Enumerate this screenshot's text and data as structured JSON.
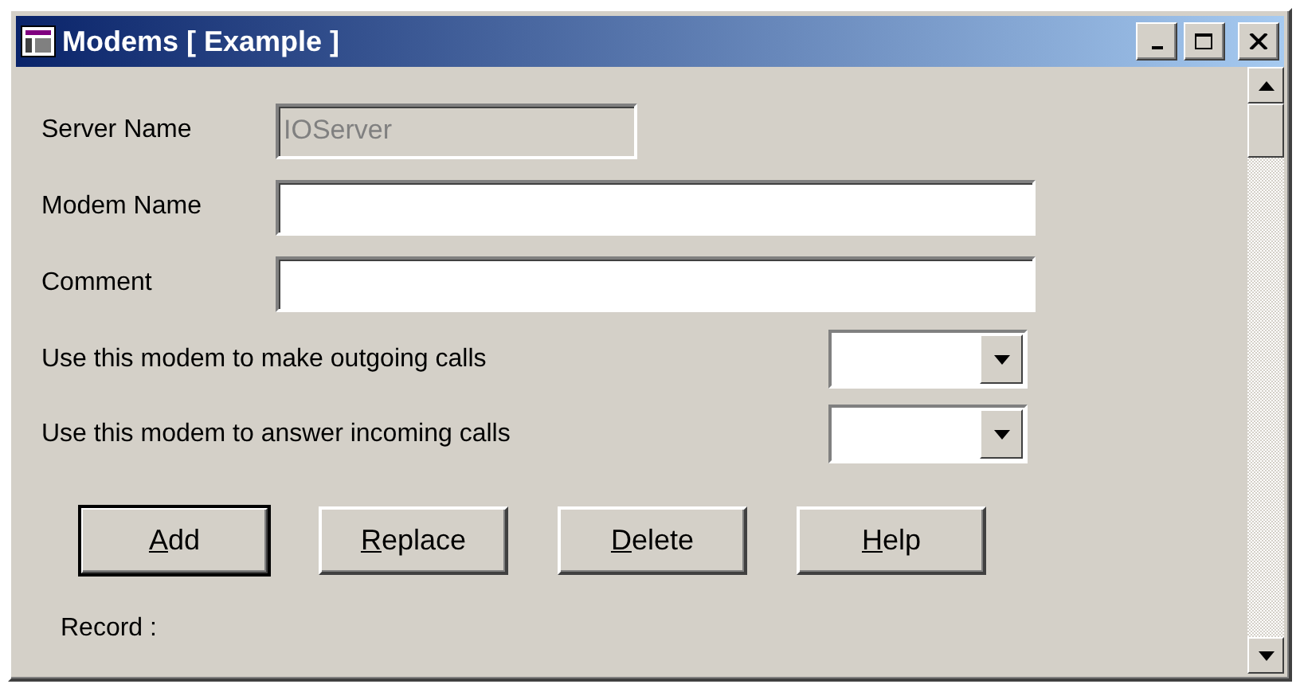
{
  "window": {
    "title": "Modems [ Example ]"
  },
  "fields": [
    {
      "label": "Server Name",
      "value": "IOServer",
      "disabled": true
    },
    {
      "label": "Modem Name",
      "disabled": false
    },
    {
      "label": "Comment",
      "disabled": false
    }
  ],
  "dropdowns": [
    {
      "label": "Use this modem to make outgoing calls"
    },
    {
      "label": "Use this modem to answer incoming calls"
    }
  ],
  "buttons": [
    {
      "mnemonic": "A",
      "rest": "dd",
      "default": true
    },
    {
      "mnemonic": "R",
      "rest": "eplace",
      "default": false
    },
    {
      "mnemonic": "D",
      "rest": "elete",
      "default": false
    },
    {
      "mnemonic": "H",
      "rest": "elp",
      "default": false
    }
  ],
  "status": {
    "label": "Record :"
  }
}
